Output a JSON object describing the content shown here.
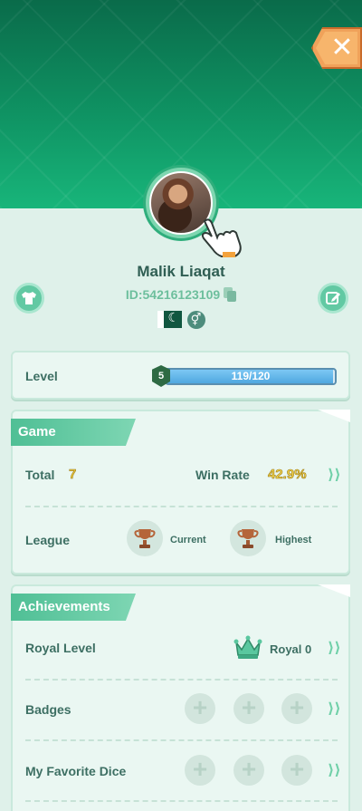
{
  "profile": {
    "name": "Malik Liaqat",
    "id_text": "ID:54216123109",
    "flag": "Pakistan",
    "gender_symbol": "⚥"
  },
  "close_button": {
    "symbol": "✕"
  },
  "level": {
    "label": "Level",
    "badge": "5",
    "progress_text": "119/120",
    "progress_fraction": 0.99
  },
  "game": {
    "title": "Game",
    "total_label": "Total",
    "total_value": "7",
    "winrate_label": "Win Rate",
    "winrate_value": "42.9%",
    "league_label": "League",
    "current_label": "Current",
    "highest_label": "Highest"
  },
  "achievements": {
    "title": "Achievements",
    "royal_level_label": "Royal Level",
    "royal_value": "Royal 0",
    "badges_label": "Badges",
    "dice_label": "My Favorite Dice",
    "plus_symbol": "+"
  },
  "chevron": "⟩⟩",
  "colors": {
    "accent": "#4fbf95",
    "header": "#0f9363",
    "close": "#f0a25a"
  }
}
